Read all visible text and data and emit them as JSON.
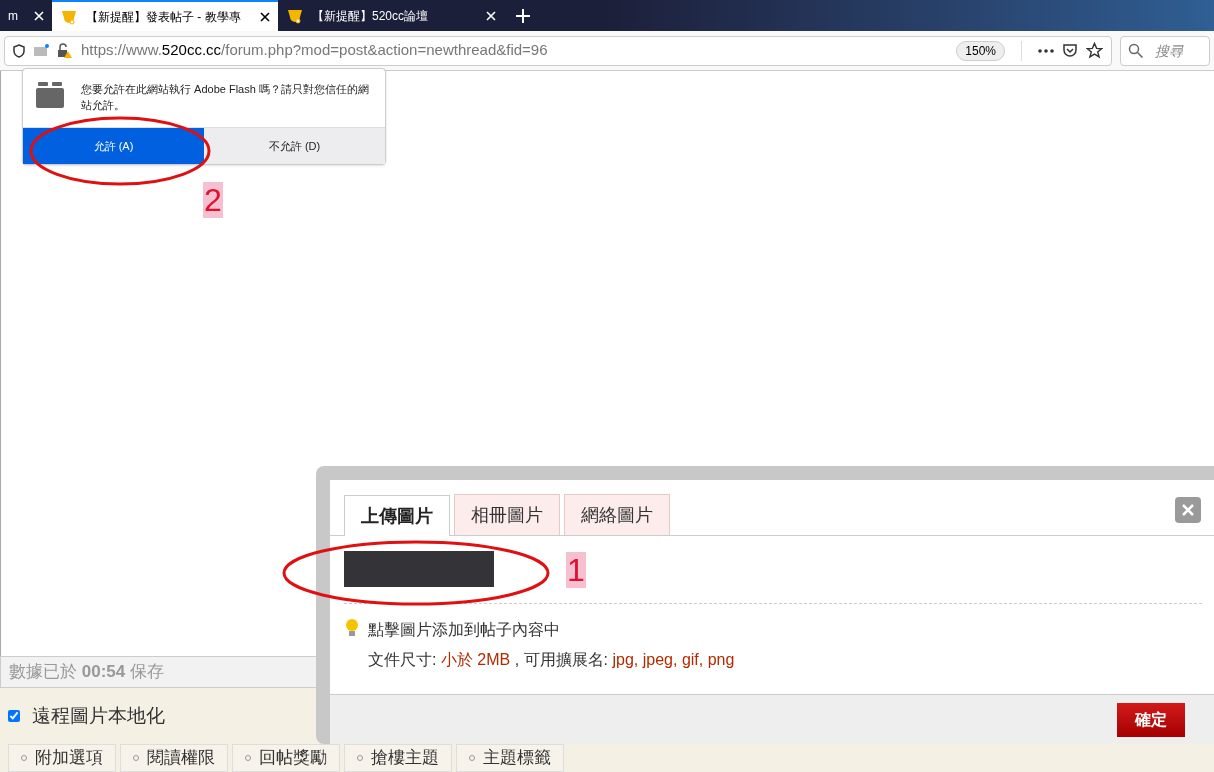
{
  "browser": {
    "tabs": [
      {
        "title": "m",
        "selected": false
      },
      {
        "title": "【新提醒】發表帖子 - 教學專",
        "selected": true
      },
      {
        "title": "【新提醒】520cc論壇",
        "selected": false
      }
    ],
    "address": {
      "url_prefix": "https://www.",
      "url_domain": "520cc.cc",
      "url_path": "/forum.php?mod=post&action=newthread&fid=96",
      "zoom": "150%"
    },
    "search": {
      "placeholder": "搜尋"
    }
  },
  "flash_prompt": {
    "message": "您要允許在此網站執行 Adobe Flash 嗎？請只對您信任的網站允許。",
    "buttons": [
      {
        "label": "允許 (A)",
        "selected": true
      },
      {
        "label": "不允許 (D)",
        "selected": false
      }
    ]
  },
  "editor": {
    "save_status": "數據已於 **00:54** 保存"
  },
  "options": {
    "remote_images": {
      "label": "遠程圖片本地化",
      "checked": true
    },
    "tabs": [
      "附加選項",
      "閱讀權限",
      "回帖獎勵",
      "搶樓主題",
      "主題標籤"
    ]
  },
  "image_dialog": {
    "tabs": [
      {
        "label": "上傳圖片",
        "selected": true
      },
      {
        "label": "相冊圖片",
        "selected": false
      },
      {
        "label": "網絡圖片",
        "selected": false
      }
    ],
    "hint": "點擊圖片添加到帖子內容中",
    "size_label": "文件尺寸:",
    "size_value": "小於 2MB",
    "ext_label": ", 可用擴展名:",
    "ext_value": "jpg, jpeg, gif, png",
    "confirm": "確定"
  },
  "annotations": [
    {
      "label": "1"
    },
    {
      "label": "2"
    }
  ]
}
